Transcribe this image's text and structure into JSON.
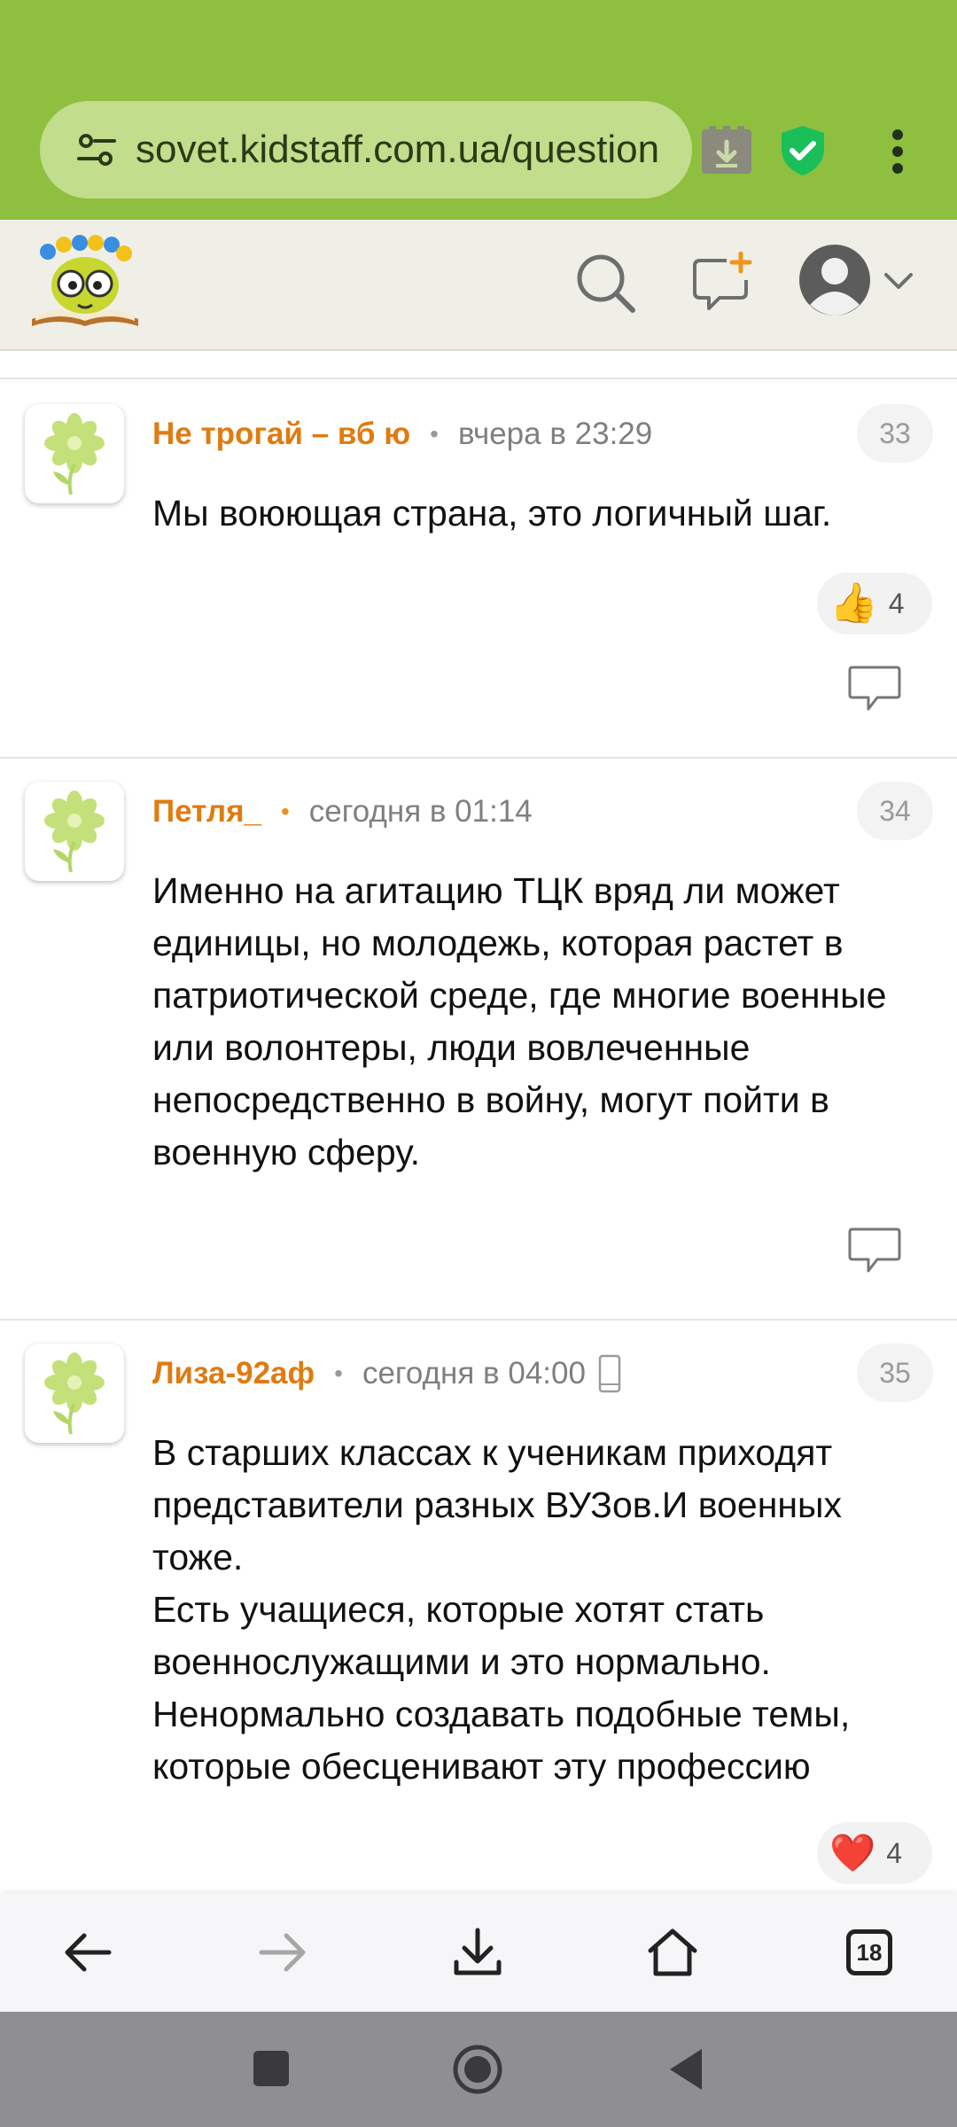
{
  "browser": {
    "url": "sovet.kidstaff.com.ua/question",
    "tabs_count": "18"
  },
  "comments": [
    {
      "author": "Не трогай – вб ю",
      "time": "вчера в 23:29",
      "number": "33",
      "text": [
        "Мы воюющая страна, это логичный шаг."
      ],
      "reaction": {
        "emoji": "👍",
        "count": "4"
      }
    },
    {
      "author": "Петля_",
      "time": "сегодня в 01:14",
      "number": "34",
      "text": [
        "Именно на агитацию ТЦК вряд ли может единицы, но молодежь, которая растет в патриотической среде, где многие военные или волонтеры, люди вовлеченные непосредственно в войну, могут пойти в военную сферу."
      ]
    },
    {
      "author": "Лиза-92аф",
      "time": "сегодня в 04:00",
      "number": "35",
      "text": [
        "В старших классах к ученикам приходят представители разных ВУЗов.И военных тоже.",
        "Есть учащиеся, которые хотят стать военнослужащими и это нормально.",
        "Ненормально создавать подобные темы, которые обесценивают эту профессию"
      ],
      "reaction": {
        "emoji": "❤️",
        "count": "4"
      }
    }
  ]
}
